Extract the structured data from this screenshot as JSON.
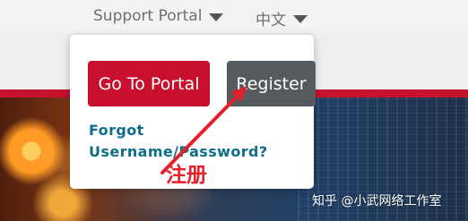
{
  "topnav": {
    "portal_label": "Support Portal",
    "language_label": "中文"
  },
  "popup": {
    "go_portal_label": "Go To Portal",
    "register_label": "Register",
    "forgot_line1": "Forgot",
    "forgot_line2": "Username/Password?"
  },
  "annotation": {
    "text": "注册",
    "color": "#e5202b"
  },
  "watermark": {
    "text": "知乎 @小武网络工作室"
  },
  "colors": {
    "brand_red": "#c8102e",
    "link_teal": "#0e6e89",
    "register_gray": "#555a5e"
  }
}
